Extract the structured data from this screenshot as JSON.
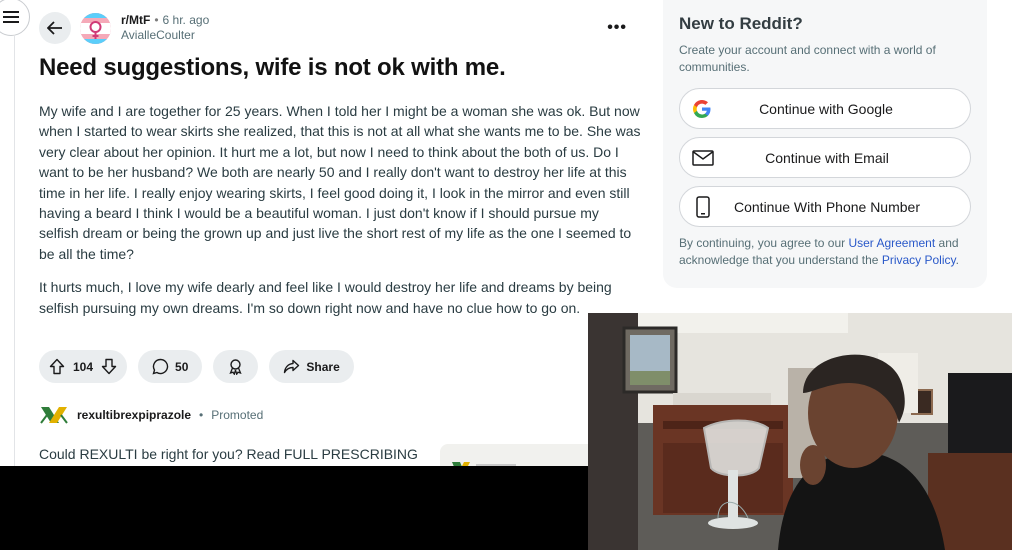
{
  "post": {
    "subreddit": "r/MtF",
    "separator": "•",
    "time": "6 hr. ago",
    "author": "AvialleCoulter",
    "more_label": "•••",
    "title": "Need suggestions, wife is not ok with me.",
    "paragraphs": [
      "My wife and I are together for 25 years. When I told her I might be a woman she was ok. But now when I started to wear skirts she realized, that this is not at all what she wants me to be. She was very clear about her opinion. It hurt me a lot, but now I need to think about the both of us. Do I want to be her husband? We both are nearly 50 and I really don't want to destroy her life at this time in her life. I really enjoy wearing skirts, I feel good doing it, I look in the mirror and even still having a beard I think I would be a beautiful woman. I just don't know if I should pursue my selfish dream or being the grown up and just live the short rest of my life as the one I seemed to be all the time?",
      "It hurts much, I love my wife dearly and feel like I would destroy her life and dreams by being selfish pursuing my own dreams. I'm so down right now and have no clue how to go on."
    ]
  },
  "actions": {
    "votes": "104",
    "comments": "50",
    "share": "Share"
  },
  "promo": {
    "name": "rexultibrexpiprazole",
    "separator": "•",
    "tag": "Promoted",
    "text": "Could REXULTI be right for you? Read FULL PRESCRIBING"
  },
  "signup": {
    "title": "New to Reddit?",
    "subtitle": "Create your account and connect with a world of communities.",
    "google": "Continue with Google",
    "email": "Continue with Email",
    "phone": "Continue With Phone Number",
    "legal_prefix": "By continuing, you agree to our",
    "user_agreement": "User Agreement",
    "legal_mid": "and acknowledge that you understand the",
    "privacy_policy": "Privacy Policy",
    "legal_suffix": "."
  },
  "icons": {
    "menu": "hamburger-icon",
    "back": "arrow-left-icon",
    "upvote": "arrow-up-icon",
    "downvote": "arrow-down-icon",
    "comment": "speech-bubble-icon",
    "award": "award-icon",
    "share": "share-arrow-icon",
    "google": "google-icon",
    "email": "envelope-icon",
    "phone": "phone-icon"
  },
  "colors": {
    "link": "#2a59c9",
    "pill_bg": "#eaedef",
    "sidebar_bg": "#f6f7f8"
  }
}
